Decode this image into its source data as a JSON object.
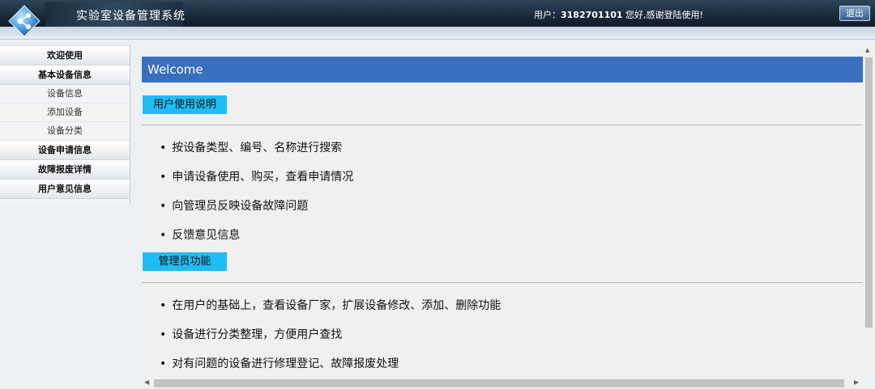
{
  "header": {
    "app_title": "实验室设备管理系统",
    "user_label": "用户：",
    "user_id": "3182701101",
    "greeting": " 您好,感谢登陆使用!",
    "logout_label": "退出"
  },
  "sidebar": {
    "items": [
      {
        "label": "欢迎使用"
      },
      {
        "label": "基本设备信息"
      },
      {
        "label": "设备信息"
      },
      {
        "label": "添加设备"
      },
      {
        "label": "设备分类"
      },
      {
        "label": "设备申请信息"
      },
      {
        "label": "故障报废详情"
      },
      {
        "label": "用户意见信息"
      }
    ]
  },
  "main": {
    "welcome": "Welcome",
    "sections": [
      {
        "title": "用户使用说明",
        "bullets": [
          "按设备类型、编号、名称进行搜索",
          "申请设备使用、购买，查看申请情况",
          "向管理员反映设备故障问题",
          "反馈意见信息"
        ]
      },
      {
        "title": "管理员功能",
        "bullets": [
          "在用户的基础上，查看设备厂家，扩展设备修改、添加、删除功能",
          "设备进行分类整理，方便用户查找",
          "对有问题的设备进行修理登记、故障报废处理"
        ]
      }
    ]
  },
  "colors": {
    "header_dark": "#1b2c3c",
    "welcome_bar": "#3a6fbe",
    "section_title": "#1fbdf5"
  }
}
